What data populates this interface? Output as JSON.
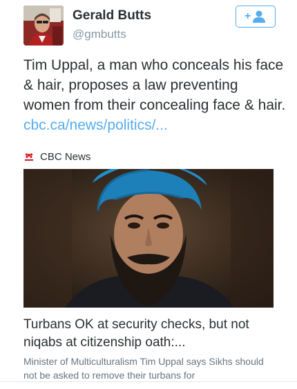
{
  "user": {
    "name": "Gerald Butts",
    "handle": "@gmbutts"
  },
  "follow_button": {
    "label": "+",
    "icon": "add-user-icon"
  },
  "tweet": {
    "text": "Tim Uppal, a man who conceals his face & hair, proposes a law preventing women from their concealing face & hair.",
    "link": "cbc.ca/news/politics/..."
  },
  "card": {
    "source": "CBC News",
    "title": "Turbans OK at security checks, but not niqabs at citizenship oath:...",
    "description": "Minister of Multiculturalism Tim Uppal says Sikhs should not be asked to remove their turbans for"
  },
  "colors": {
    "accent": "#55acee",
    "text": "#292f33",
    "muted": "#8899a6",
    "cbc_red": "#d71920"
  }
}
